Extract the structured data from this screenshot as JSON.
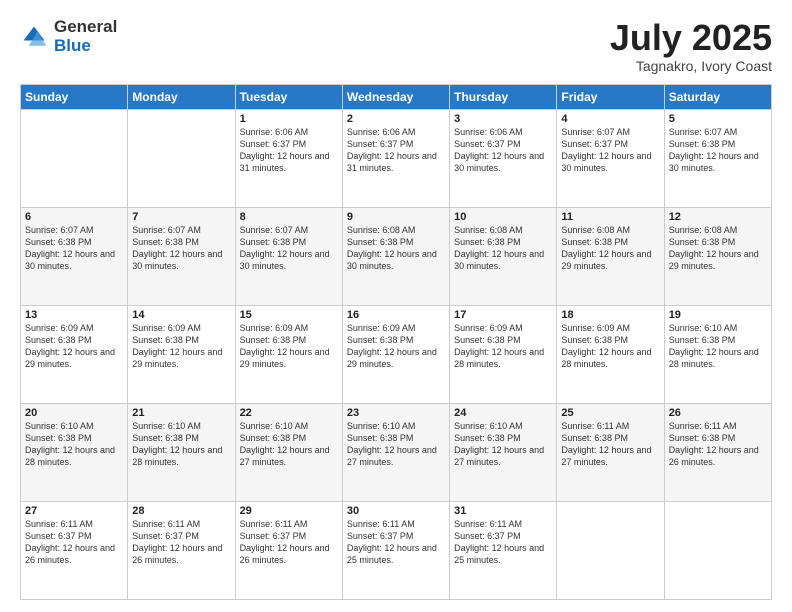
{
  "logo": {
    "general": "General",
    "blue": "Blue"
  },
  "title": "July 2025",
  "location": "Tagnakro, Ivory Coast",
  "days_of_week": [
    "Sunday",
    "Monday",
    "Tuesday",
    "Wednesday",
    "Thursday",
    "Friday",
    "Saturday"
  ],
  "weeks": [
    [
      {
        "day": "",
        "info": ""
      },
      {
        "day": "",
        "info": ""
      },
      {
        "day": "1",
        "info": "Sunrise: 6:06 AM\nSunset: 6:37 PM\nDaylight: 12 hours and 31 minutes."
      },
      {
        "day": "2",
        "info": "Sunrise: 6:06 AM\nSunset: 6:37 PM\nDaylight: 12 hours and 31 minutes."
      },
      {
        "day": "3",
        "info": "Sunrise: 6:06 AM\nSunset: 6:37 PM\nDaylight: 12 hours and 30 minutes."
      },
      {
        "day": "4",
        "info": "Sunrise: 6:07 AM\nSunset: 6:37 PM\nDaylight: 12 hours and 30 minutes."
      },
      {
        "day": "5",
        "info": "Sunrise: 6:07 AM\nSunset: 6:38 PM\nDaylight: 12 hours and 30 minutes."
      }
    ],
    [
      {
        "day": "6",
        "info": "Sunrise: 6:07 AM\nSunset: 6:38 PM\nDaylight: 12 hours and 30 minutes."
      },
      {
        "day": "7",
        "info": "Sunrise: 6:07 AM\nSunset: 6:38 PM\nDaylight: 12 hours and 30 minutes."
      },
      {
        "day": "8",
        "info": "Sunrise: 6:07 AM\nSunset: 6:38 PM\nDaylight: 12 hours and 30 minutes."
      },
      {
        "day": "9",
        "info": "Sunrise: 6:08 AM\nSunset: 6:38 PM\nDaylight: 12 hours and 30 minutes."
      },
      {
        "day": "10",
        "info": "Sunrise: 6:08 AM\nSunset: 6:38 PM\nDaylight: 12 hours and 30 minutes."
      },
      {
        "day": "11",
        "info": "Sunrise: 6:08 AM\nSunset: 6:38 PM\nDaylight: 12 hours and 29 minutes."
      },
      {
        "day": "12",
        "info": "Sunrise: 6:08 AM\nSunset: 6:38 PM\nDaylight: 12 hours and 29 minutes."
      }
    ],
    [
      {
        "day": "13",
        "info": "Sunrise: 6:09 AM\nSunset: 6:38 PM\nDaylight: 12 hours and 29 minutes."
      },
      {
        "day": "14",
        "info": "Sunrise: 6:09 AM\nSunset: 6:38 PM\nDaylight: 12 hours and 29 minutes."
      },
      {
        "day": "15",
        "info": "Sunrise: 6:09 AM\nSunset: 6:38 PM\nDaylight: 12 hours and 29 minutes."
      },
      {
        "day": "16",
        "info": "Sunrise: 6:09 AM\nSunset: 6:38 PM\nDaylight: 12 hours and 29 minutes."
      },
      {
        "day": "17",
        "info": "Sunrise: 6:09 AM\nSunset: 6:38 PM\nDaylight: 12 hours and 28 minutes."
      },
      {
        "day": "18",
        "info": "Sunrise: 6:09 AM\nSunset: 6:38 PM\nDaylight: 12 hours and 28 minutes."
      },
      {
        "day": "19",
        "info": "Sunrise: 6:10 AM\nSunset: 6:38 PM\nDaylight: 12 hours and 28 minutes."
      }
    ],
    [
      {
        "day": "20",
        "info": "Sunrise: 6:10 AM\nSunset: 6:38 PM\nDaylight: 12 hours and 28 minutes."
      },
      {
        "day": "21",
        "info": "Sunrise: 6:10 AM\nSunset: 6:38 PM\nDaylight: 12 hours and 28 minutes."
      },
      {
        "day": "22",
        "info": "Sunrise: 6:10 AM\nSunset: 6:38 PM\nDaylight: 12 hours and 27 minutes."
      },
      {
        "day": "23",
        "info": "Sunrise: 6:10 AM\nSunset: 6:38 PM\nDaylight: 12 hours and 27 minutes."
      },
      {
        "day": "24",
        "info": "Sunrise: 6:10 AM\nSunset: 6:38 PM\nDaylight: 12 hours and 27 minutes."
      },
      {
        "day": "25",
        "info": "Sunrise: 6:11 AM\nSunset: 6:38 PM\nDaylight: 12 hours and 27 minutes."
      },
      {
        "day": "26",
        "info": "Sunrise: 6:11 AM\nSunset: 6:38 PM\nDaylight: 12 hours and 26 minutes."
      }
    ],
    [
      {
        "day": "27",
        "info": "Sunrise: 6:11 AM\nSunset: 6:37 PM\nDaylight: 12 hours and 26 minutes."
      },
      {
        "day": "28",
        "info": "Sunrise: 6:11 AM\nSunset: 6:37 PM\nDaylight: 12 hours and 26 minutes."
      },
      {
        "day": "29",
        "info": "Sunrise: 6:11 AM\nSunset: 6:37 PM\nDaylight: 12 hours and 26 minutes."
      },
      {
        "day": "30",
        "info": "Sunrise: 6:11 AM\nSunset: 6:37 PM\nDaylight: 12 hours and 25 minutes."
      },
      {
        "day": "31",
        "info": "Sunrise: 6:11 AM\nSunset: 6:37 PM\nDaylight: 12 hours and 25 minutes."
      },
      {
        "day": "",
        "info": ""
      },
      {
        "day": "",
        "info": ""
      }
    ]
  ]
}
